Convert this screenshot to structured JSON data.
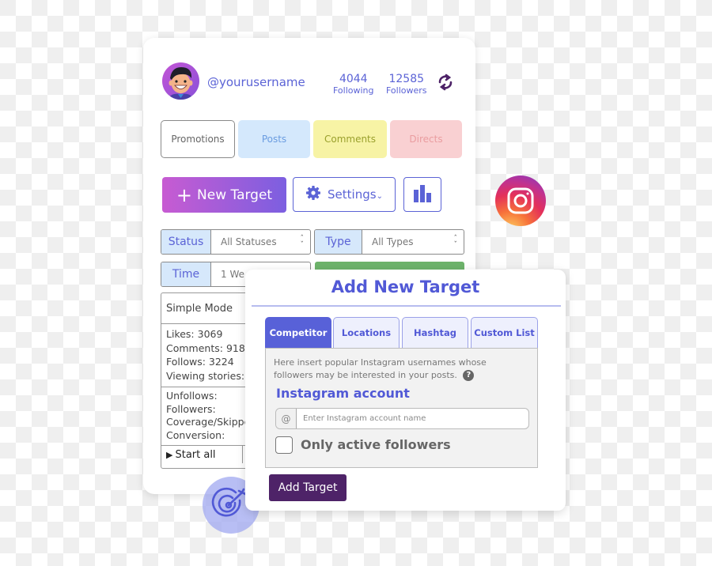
{
  "profile": {
    "username": "@yourusername",
    "following_count": "4044",
    "following_label": "Following",
    "followers_count": "12585",
    "followers_label": "Followers",
    "refresh_icon": "refresh-icon"
  },
  "categories": [
    {
      "label": "Promotions",
      "bg": "#ffffff",
      "color": "#666666",
      "border": "#8a8a8a"
    },
    {
      "label": "Posts",
      "bg": "#d4e8fc",
      "color": "#6a9ce0"
    },
    {
      "label": "Comments",
      "bg": "#f7f3a5",
      "color": "#9aa02d"
    },
    {
      "label": "Directs",
      "bg": "#f9d0d2",
      "color": "#ea9da0"
    }
  ],
  "actions": {
    "new_target": "New Target",
    "settings": "Settings",
    "stats_icon": "bar-chart-icon"
  },
  "filters": {
    "status_label": "Status",
    "status_value": "All Statuses",
    "type_label": "Type",
    "type_value": "All Types",
    "time_label": "Time",
    "time_value": "1 We"
  },
  "stats": {
    "mode": "Simple Mode",
    "group1": [
      "Likes: 3069",
      "Comments: 918",
      "Follows: 3224",
      "Viewing stories:"
    ],
    "group2": [
      "Unfollows:",
      "Followers:",
      "Coverage/Skippe",
      "Conversion:"
    ],
    "start_all": "Start all"
  },
  "dialog": {
    "title": "Add New Target",
    "tabs": [
      {
        "label": "Competitor",
        "active": true
      },
      {
        "label": "Locations",
        "active": false
      },
      {
        "label": "Hashtag",
        "active": false
      },
      {
        "label": "Custom List",
        "active": false
      }
    ],
    "description": "Here insert popular Instagram usernames whose followers may be interested in your posts.",
    "help_glyph": "?",
    "account_label": "Instagram account",
    "account_prefix": "@",
    "account_placeholder": "Enter Instagram account name",
    "account_value": "",
    "only_active_label": "Only active followers",
    "only_active_checked": false,
    "submit": "Add Target"
  },
  "colors": {
    "accent": "#5b63d6",
    "primary_button": "#4e2368",
    "green_bar": "#6db36b"
  }
}
